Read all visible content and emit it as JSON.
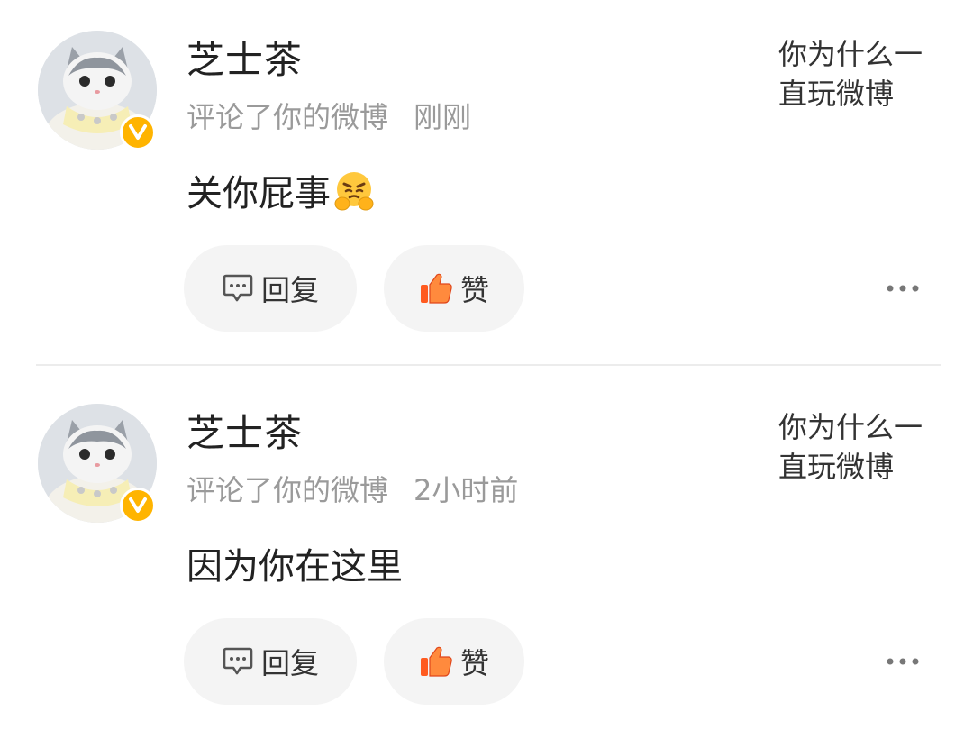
{
  "comments": [
    {
      "user": "芝士茶",
      "action": "评论了你的微博",
      "time": "刚刚",
      "text": "关你屁事",
      "has_emoji": true,
      "emoji_icon": "huffing-face-emoji",
      "original_post": "你为什么一直玩微博",
      "reply_label": "回复",
      "like_label": "赞"
    },
    {
      "user": "芝士茶",
      "action": "评论了你的微博",
      "time": "2小时前",
      "text": "因为你在这里",
      "has_emoji": false,
      "original_post": "你为什么一直玩微博",
      "reply_label": "回复",
      "like_label": "赞"
    }
  ],
  "colors": {
    "verified_badge": "#ffb400",
    "like_icon": "#ff5a1f",
    "secondary_text": "#9a9a9a",
    "button_bg": "#f4f4f4"
  }
}
